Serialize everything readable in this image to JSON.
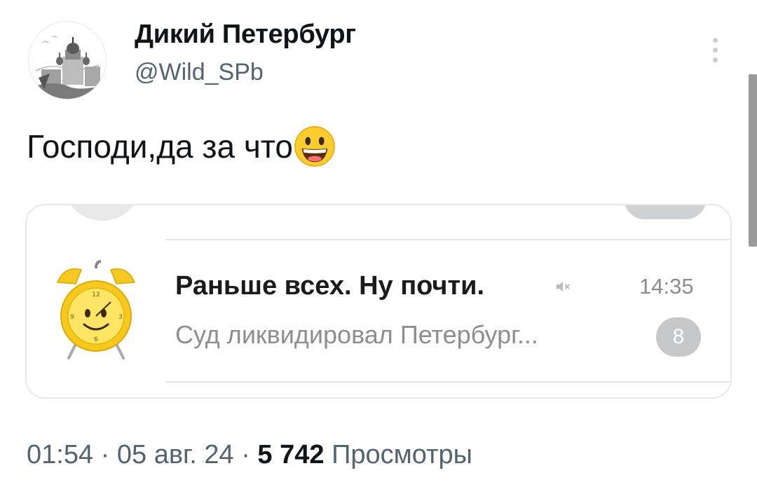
{
  "author": {
    "name": "Дикий Петербург",
    "handle": "@Wild_SPb"
  },
  "tweet": {
    "text": "Господи,да за что",
    "emoji_icon": "grinning-face-icon"
  },
  "media": {
    "chat": {
      "title": "Раньше всех. Ну почти.",
      "time": "14:35",
      "preview": "Суд ликвидировал Петербург...",
      "unread_count": "8",
      "muted_icon": "muted-speaker-icon",
      "avatar_icon": "alarm-clock-icon"
    }
  },
  "meta": {
    "time": "01:54",
    "separator": " · ",
    "date": "05 авг. 24",
    "views_count": "5 742",
    "views_label": "Просмотры"
  },
  "colors": {
    "secondary_text": "#536471",
    "card_border": "#e7e9ea",
    "badge": "#c5c7c9"
  }
}
